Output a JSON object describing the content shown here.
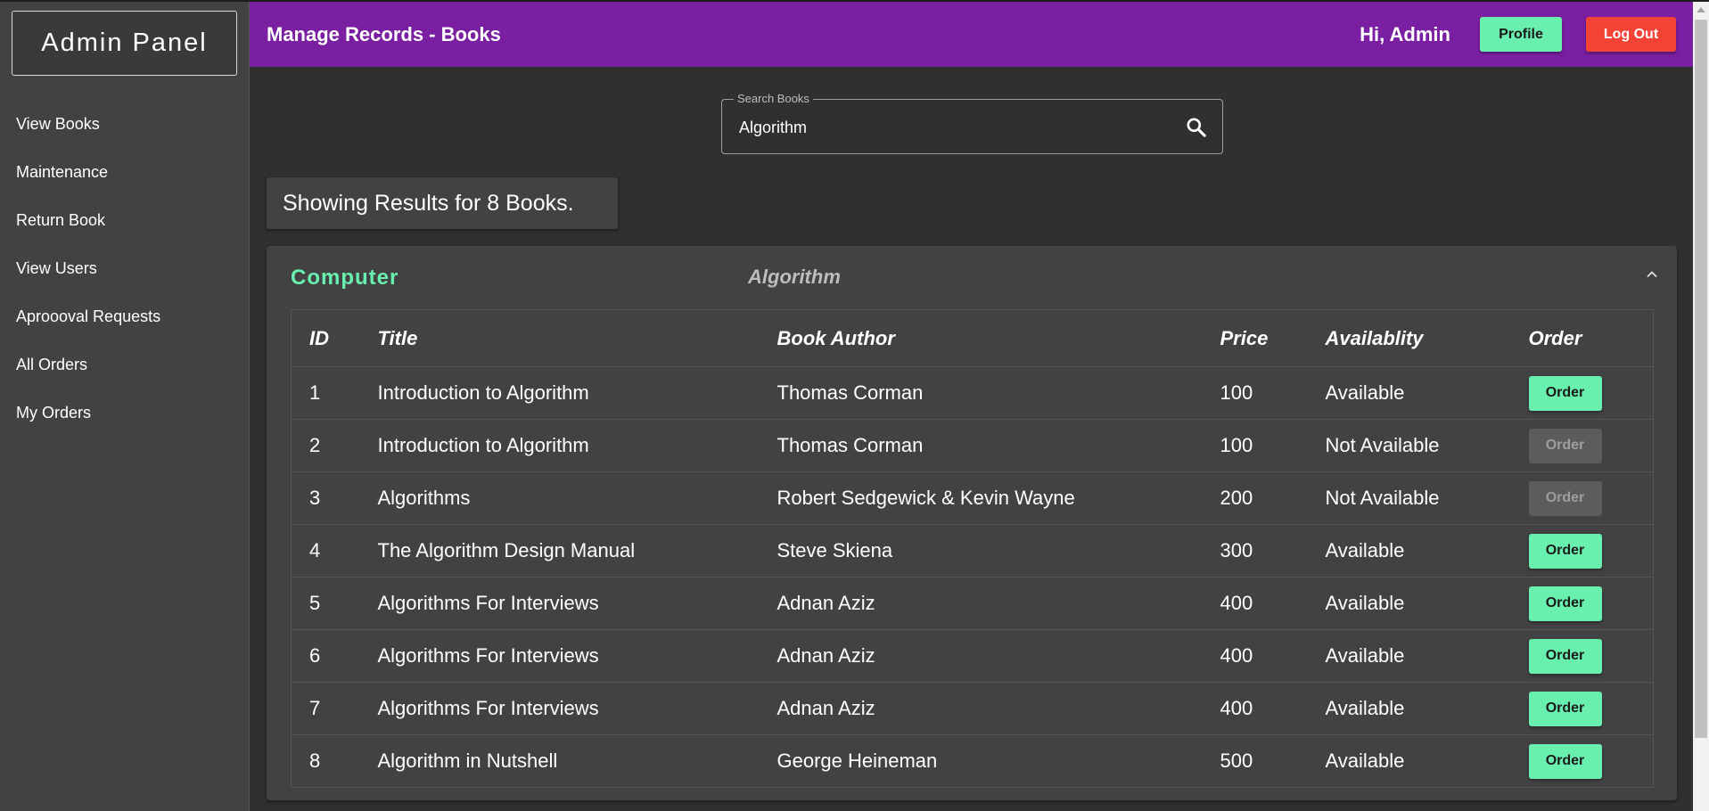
{
  "sidebar": {
    "brand": "Admin Panel",
    "items": [
      {
        "label": "View Books",
        "active": true
      },
      {
        "label": "Maintenance",
        "active": false
      },
      {
        "label": "Return Book",
        "active": false
      },
      {
        "label": "View Users",
        "active": false
      },
      {
        "label": "Aproooval Requests",
        "active": false
      },
      {
        "label": "All Orders",
        "active": false
      },
      {
        "label": "My Orders",
        "active": false
      }
    ]
  },
  "header": {
    "title": "Manage Records - Books",
    "greeting": "Hi, Admin",
    "profile_label": "Profile",
    "logout_label": "Log Out"
  },
  "search": {
    "legend": "Search Books",
    "value": "Algorithm"
  },
  "results": {
    "text": "Showing Results for 8 Books."
  },
  "panel": {
    "category": "Computer",
    "query": "Algorithm",
    "columns": [
      "ID",
      "Title",
      "Book Author",
      "Price",
      "Availablity",
      "Order"
    ],
    "rows": [
      {
        "id": "1",
        "title": "Introduction to Algorithm",
        "author": "Thomas Corman",
        "price": "100",
        "availability": "Available",
        "order": "Order",
        "enabled": true
      },
      {
        "id": "2",
        "title": "Introduction to Algorithm",
        "author": "Thomas Corman",
        "price": "100",
        "availability": "Not Available",
        "order": "Order",
        "enabled": false
      },
      {
        "id": "3",
        "title": "Algorithms",
        "author": "Robert Sedgewick & Kevin Wayne",
        "price": "200",
        "availability": "Not Available",
        "order": "Order",
        "enabled": false
      },
      {
        "id": "4",
        "title": "The Algorithm Design Manual",
        "author": "Steve Skiena",
        "price": "300",
        "availability": "Available",
        "order": "Order",
        "enabled": true
      },
      {
        "id": "5",
        "title": "Algorithms For Interviews",
        "author": "Adnan Aziz",
        "price": "400",
        "availability": "Available",
        "order": "Order",
        "enabled": true
      },
      {
        "id": "6",
        "title": "Algorithms For Interviews",
        "author": "Adnan Aziz",
        "price": "400",
        "availability": "Available",
        "order": "Order",
        "enabled": true
      },
      {
        "id": "7",
        "title": "Algorithms For Interviews",
        "author": "Adnan Aziz",
        "price": "400",
        "availability": "Available",
        "order": "Order",
        "enabled": true
      },
      {
        "id": "8",
        "title": "Algorithm in Nutshell",
        "author": "George Heineman",
        "price": "500",
        "availability": "Available",
        "order": "Order",
        "enabled": true
      }
    ]
  },
  "colors": {
    "appbar": "#7b1fa2",
    "accent_green": "#69f0ae",
    "danger_red": "#f44336",
    "background": "#303030",
    "surface": "#424242"
  }
}
